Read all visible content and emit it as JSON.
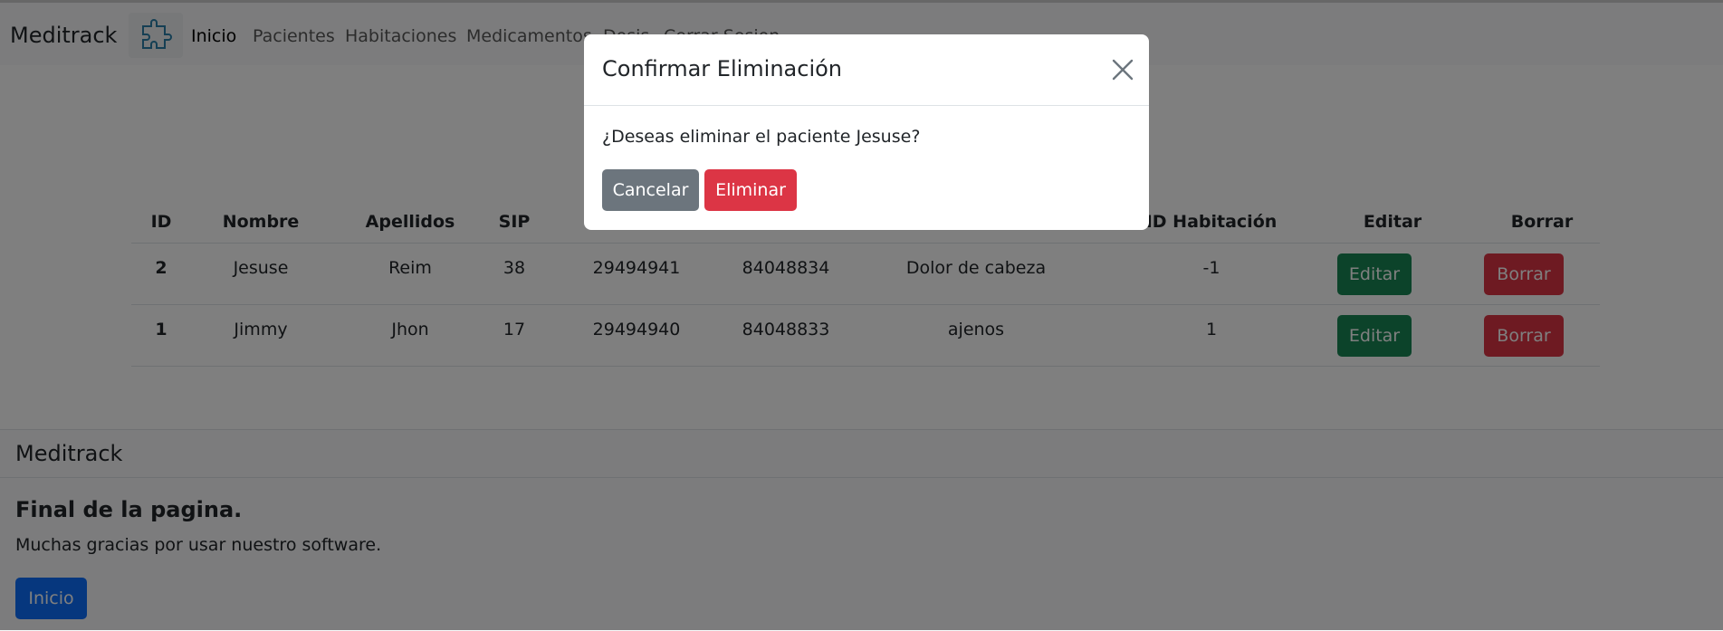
{
  "navbar": {
    "brand": "Meditrack",
    "links": [
      "Inicio",
      "Pacientes",
      "Habitaciones",
      "Medicamentos",
      "Dosis",
      "Cerrar Sesion"
    ]
  },
  "table": {
    "headers": [
      "ID",
      "Nombre",
      "Apellidos",
      "SIP",
      "",
      "",
      "",
      "ID Habitación",
      "Editar",
      "Borrar"
    ],
    "rows": [
      {
        "id": "2",
        "nombre": "Jesuse",
        "apellidos": "Reim",
        "sip": "38",
        "c5": "29494941",
        "c6": "84048834",
        "c7": "Dolor de cabeza",
        "habitacion": "-1",
        "edit": "Editar",
        "del": "Borrar"
      },
      {
        "id": "1",
        "nombre": "Jimmy",
        "apellidos": "Jhon",
        "sip": "17",
        "c5": "29494940",
        "c6": "84048833",
        "c7": "ajenos",
        "habitacion": "1",
        "edit": "Editar",
        "del": "Borrar"
      }
    ]
  },
  "footer": {
    "brand": "Meditrack",
    "title": "Final de la pagina.",
    "text": "Muchas gracias por usar nuestro software.",
    "button": "Inicio"
  },
  "modal": {
    "title": "Confirmar Eliminación",
    "message": "¿Deseas eliminar el paciente Jesuse?",
    "cancel": "Cancelar",
    "confirm": "Eliminar"
  },
  "icons": {
    "logo": "puzzle-piece-icon",
    "close": "close-icon"
  }
}
